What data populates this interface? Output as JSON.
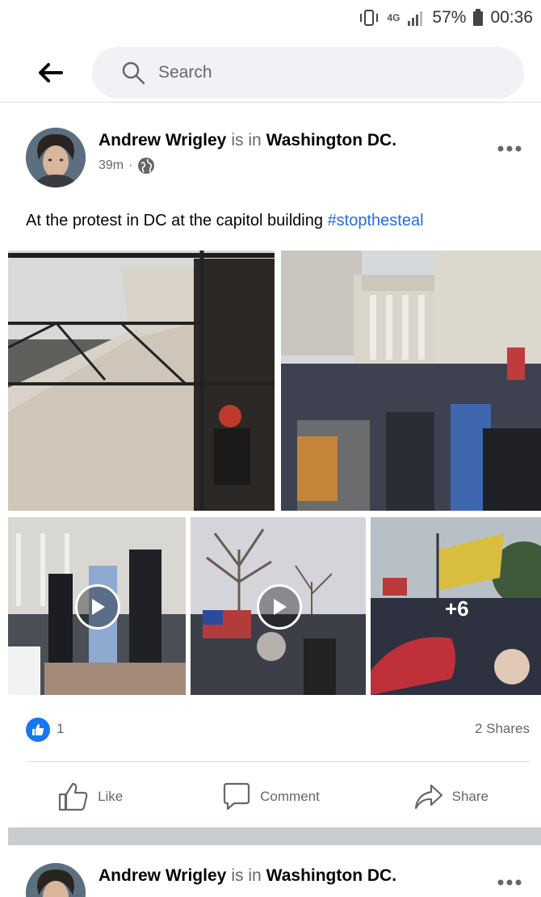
{
  "status_bar": {
    "network": "4G",
    "battery": "57%",
    "time": "00:36"
  },
  "header": {
    "search_placeholder": "Search"
  },
  "post": {
    "author": "Andrew Wrigley",
    "connector": "is in",
    "location": "Washington DC.",
    "time_ago": "39m",
    "text": "At the protest in DC at the capitol building",
    "hashtag": "#stopthesteal",
    "photos_more": "+6",
    "like_count": "1",
    "shares": "2 Shares",
    "actions": {
      "like": "Like",
      "comment": "Comment",
      "share": "Share"
    }
  },
  "next_post": {
    "author": "Andrew Wrigley",
    "connector": "is in",
    "location": "Washington DC."
  },
  "colors": {
    "brand_blue": "#1877f2",
    "hashtag": "#216fdb",
    "secondary_text": "#65676b",
    "search_bg": "#f0f2f5"
  },
  "icons": [
    "vibrate-icon",
    "signal-icon",
    "battery-icon",
    "back-arrow-icon",
    "search-icon",
    "globe-icon",
    "more-icon",
    "play-icon",
    "like-thumb-icon",
    "comment-icon",
    "share-icon"
  ]
}
